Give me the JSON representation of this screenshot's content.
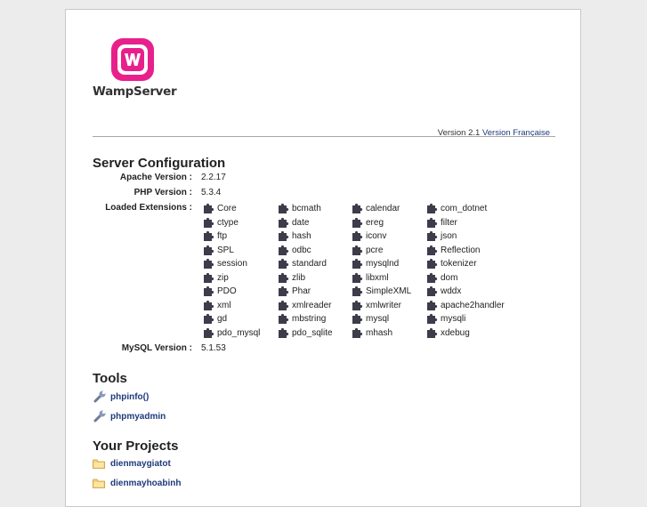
{
  "logo": {
    "name": "WampServer",
    "accent": "#e8208c"
  },
  "header": {
    "version_text": "Version 2.1",
    "lang_link": "Version Française"
  },
  "server": {
    "title": "Server Configuration",
    "apache_label": "Apache Version :",
    "apache_value": "2.2.17",
    "php_label": "PHP Version :",
    "php_value": "5.3.4",
    "ext_label": "Loaded Extensions :",
    "extensions": [
      "Core",
      "bcmath",
      "calendar",
      "com_dotnet",
      "ctype",
      "date",
      "ereg",
      "filter",
      "ftp",
      "hash",
      "iconv",
      "json",
      "SPL",
      "odbc",
      "pcre",
      "Reflection",
      "session",
      "standard",
      "mysqlnd",
      "tokenizer",
      "zip",
      "zlib",
      "libxml",
      "dom",
      "PDO",
      "Phar",
      "SimpleXML",
      "wddx",
      "xml",
      "xmlreader",
      "xmlwriter",
      "apache2handler",
      "gd",
      "mbstring",
      "mysql",
      "mysqli",
      "pdo_mysql",
      "pdo_sqlite",
      "mhash",
      "xdebug"
    ],
    "mysql_label": "MySQL Version :",
    "mysql_value": "5.1.53"
  },
  "tools": {
    "title": "Tools",
    "items": [
      "phpinfo()",
      "phpmyadmin"
    ]
  },
  "projects": {
    "title": "Your Projects",
    "items": [
      "dienmaygiatot",
      "dienmayhoabinh"
    ]
  },
  "icons": {
    "extension": "puzzle-piece-icon",
    "tool": "wrench-icon",
    "project": "folder-icon"
  }
}
